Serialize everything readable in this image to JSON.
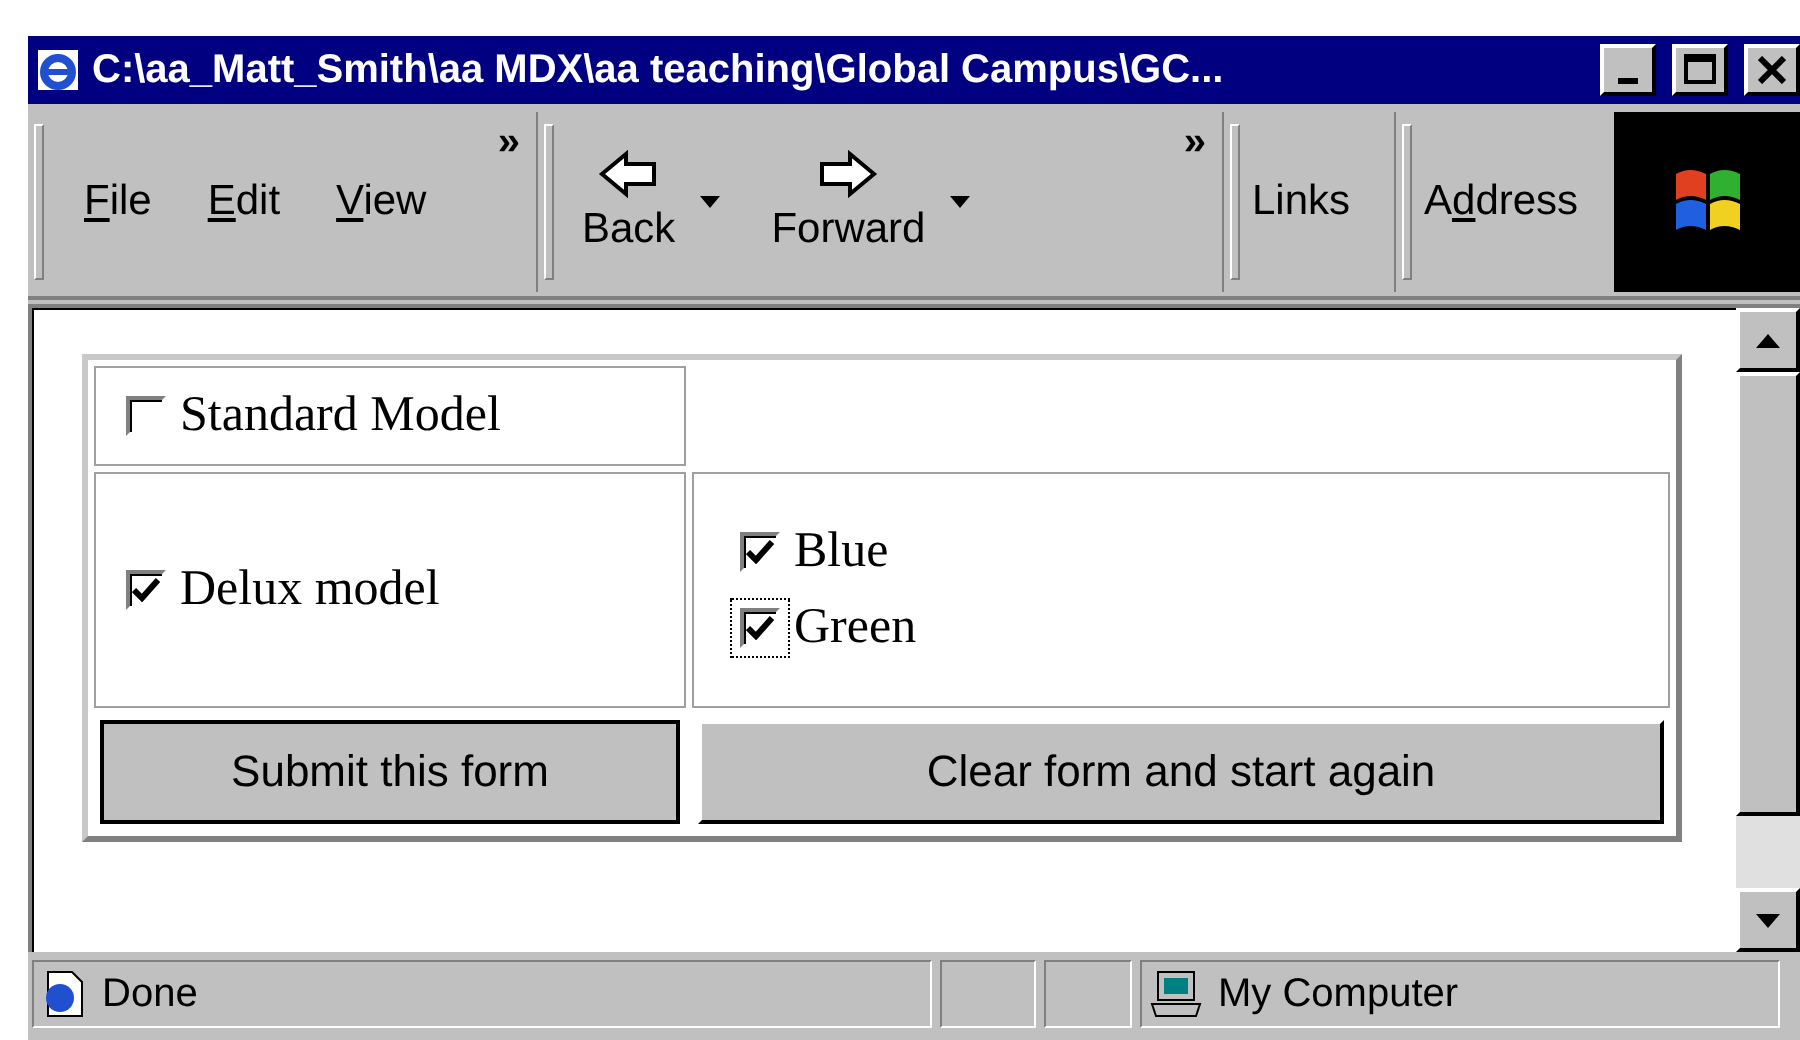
{
  "window": {
    "title": "C:\\aa_Matt_Smith\\aa MDX\\aa teaching\\Global Campus\\GC..."
  },
  "menu": [
    {
      "key": "F",
      "after": "ile"
    },
    {
      "key": "E",
      "after": "dit"
    },
    {
      "key": "V",
      "after": "iew"
    }
  ],
  "menu_more": "»",
  "nav": [
    {
      "label": "Back",
      "kind": "back"
    },
    {
      "label": "Forward",
      "kind": "forward"
    }
  ],
  "nav_more": "»",
  "links": "Links",
  "address": {
    "before": "A",
    "key": "d",
    "after": "dress"
  },
  "form": {
    "standard": {
      "label": "Standard Model",
      "checked": false
    },
    "delux": {
      "label": "Delux model",
      "checked": true
    },
    "colors": [
      {
        "label": "Blue",
        "checked": true
      },
      {
        "label": "Green",
        "checked": true,
        "focused": true
      }
    ],
    "buttons": [
      {
        "label": "Submit this form",
        "default": true
      },
      {
        "label": "Clear form and start again",
        "default": false
      }
    ]
  },
  "status_bar": {
    "text": "Done",
    "zone": "My Computer"
  }
}
